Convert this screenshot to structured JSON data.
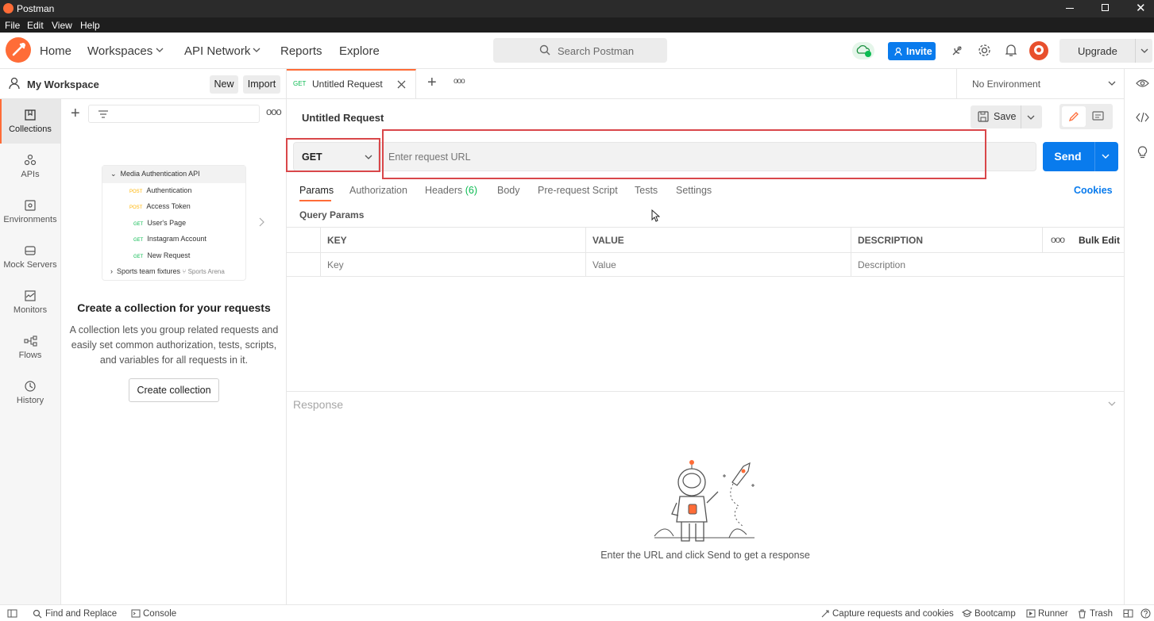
{
  "window": {
    "title": "Postman"
  },
  "menu": [
    "File",
    "Edit",
    "View",
    "Help"
  ],
  "header": {
    "nav": [
      "Home",
      "Workspaces",
      "API Network",
      "Reports",
      "Explore"
    ],
    "search_placeholder": "Search Postman",
    "invite_label": "Invite",
    "upgrade_label": "Upgrade"
  },
  "workspace": {
    "name": "My Workspace",
    "new_label": "New",
    "import_label": "Import"
  },
  "sidebar": {
    "items": [
      {
        "label": "Collections",
        "icon": "collections-icon",
        "active": true
      },
      {
        "label": "APIs",
        "icon": "apis-icon"
      },
      {
        "label": "Environments",
        "icon": "environments-icon"
      },
      {
        "label": "Mock Servers",
        "icon": "mock-servers-icon"
      },
      {
        "label": "Monitors",
        "icon": "monitors-icon"
      },
      {
        "label": "Flows",
        "icon": "flows-icon"
      },
      {
        "label": "History",
        "icon": "history-icon"
      }
    ]
  },
  "collections_panel": {
    "illustration": {
      "collection": "Media Authentication API",
      "requests": [
        {
          "method": "POST",
          "name": "Authentication"
        },
        {
          "method": "POST",
          "name": "Access Token"
        },
        {
          "method": "GET",
          "name": "User's Page"
        },
        {
          "method": "GET",
          "name": "Instagram Account"
        },
        {
          "method": "GET",
          "name": "New Request"
        }
      ],
      "second_collection": "Sports team fixtures",
      "second_workspace": "Sports Arena"
    },
    "empty_title": "Create a collection for your requests",
    "empty_desc_lines": [
      "A collection lets you group related requests and",
      "easily set common authorization, tests, scripts,",
      "and variables for all requests in it."
    ],
    "create_label": "Create collection"
  },
  "tab": {
    "method": "GET",
    "title": "Untitled Request"
  },
  "environment": {
    "selected": "No Environment"
  },
  "request": {
    "title": "Untitled Request",
    "save_label": "Save",
    "method": "GET",
    "url_placeholder": "Enter request URL",
    "send_label": "Send",
    "subtabs": [
      "Params",
      "Authorization",
      "Headers",
      "Body",
      "Pre-request Script",
      "Tests",
      "Settings"
    ],
    "headers_count": "(6)",
    "cookies_label": "Cookies",
    "query_params_label": "Query Params",
    "table": {
      "columns": [
        "KEY",
        "VALUE",
        "DESCRIPTION"
      ],
      "bulk_edit_label": "Bulk Edit",
      "placeholders": [
        "Key",
        "Value",
        "Description"
      ]
    }
  },
  "response": {
    "label": "Response",
    "empty_text": "Enter the URL and click Send to get a response"
  },
  "footer": {
    "left": [
      "Find and Replace",
      "Console"
    ],
    "right": [
      "Capture requests and cookies",
      "Bootcamp",
      "Runner",
      "Trash"
    ]
  },
  "colors": {
    "accent": "#ff6c37",
    "primary": "#097bed",
    "get": "#0cbb52",
    "post": "#ffb400",
    "highlight": "#d9474a"
  }
}
